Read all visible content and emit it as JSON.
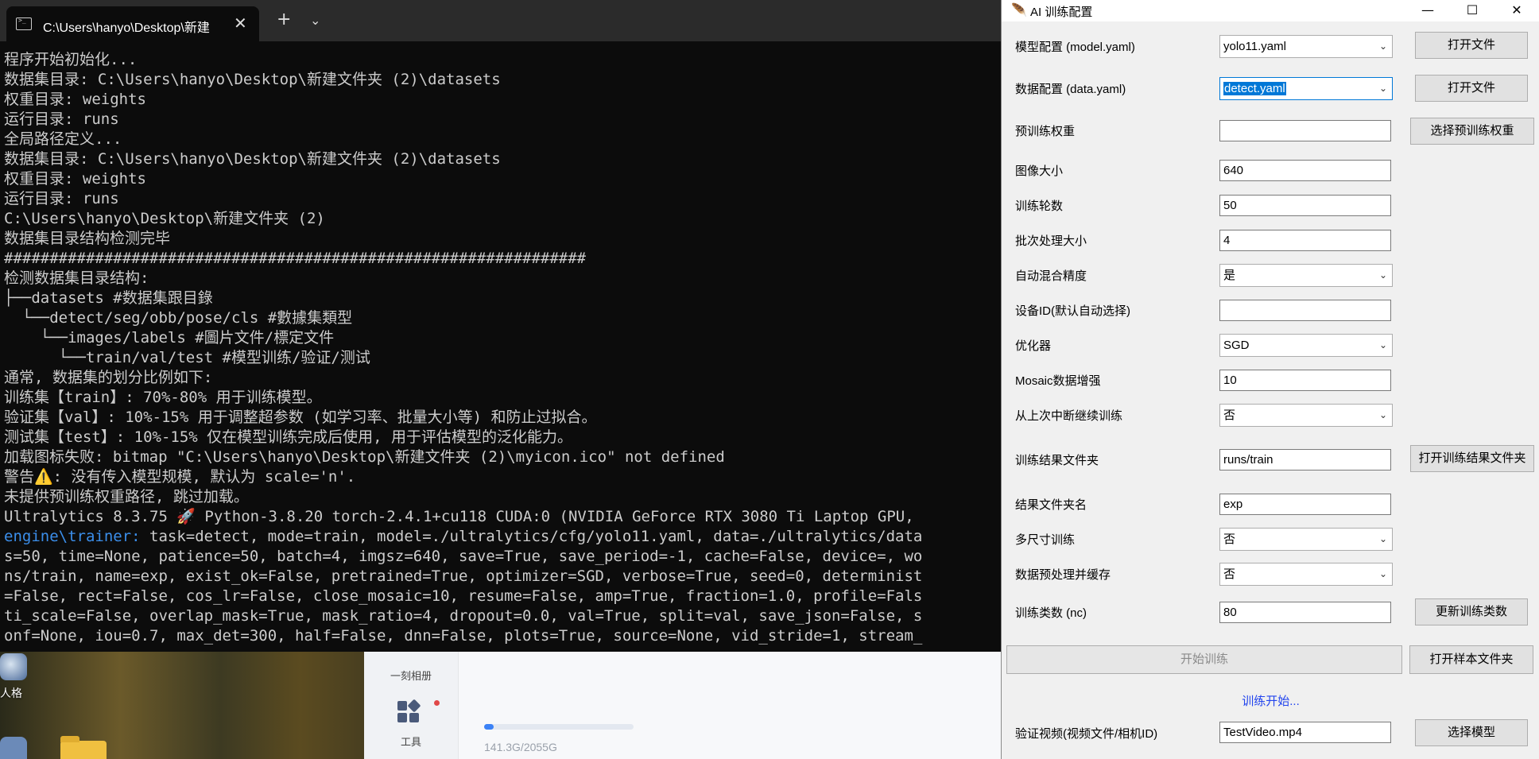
{
  "terminal": {
    "tab_title": "C:\\Users\\hanyo\\Desktop\\新建",
    "lines": [
      "程序开始初始化...",
      "数据集目录: C:\\Users\\hanyo\\Desktop\\新建文件夹 (2)\\datasets",
      "权重目录: weights",
      "运行目录: runs",
      "全局路径定义...",
      "数据集目录: C:\\Users\\hanyo\\Desktop\\新建文件夹 (2)\\datasets",
      "权重目录: weights",
      "运行目录: runs",
      "C:\\Users\\hanyo\\Desktop\\新建文件夹 (2)",
      "数据集目录结构检测完毕",
      "################################################################",
      "检测数据集目录结构:",
      "├──datasets #数据集跟目錄",
      "  └──detect/seg/obb/pose/cls #數據集類型",
      "    └──images/labels #圖片文件/標定文件",
      "      └──train/val/test #模型训练/验证/测试",
      "通常, 数据集的划分比例如下:",
      "训练集【train】: 70%-80% 用于训练模型。",
      "验证集【val】: 10%-15% 用于调整超参数 (如学习率、批量大小等) 和防止过拟合。",
      "测试集【test】: 10%-15% 仅在模型训练完成后使用, 用于评估模型的泛化能力。",
      "加载图标失败: bitmap \"C:\\Users\\hanyo\\Desktop\\新建文件夹 (2)\\myicon.ico\" not defined",
      "警告⚠️: 没有传入模型规模, 默认为 scale='n'.",
      "未提供预训练权重路径, 跳过加载。",
      "Ultralytics 8.3.75 🚀 Python-3.8.20 torch-2.4.1+cu118 CUDA:0 (NVIDIA GeForce RTX 3080 Ti Laptop GPU,",
      " task=detect, mode=train, model=./ultralytics/cfg/yolo11.yaml, data=./ultralytics/data",
      "s=50, time=None, patience=50, batch=4, imgsz=640, save=True, save_period=-1, cache=False, device=, wo",
      "ns/train, name=exp, exist_ok=False, pretrained=True, optimizer=SGD, verbose=True, seed=0, determinist",
      "=False, rect=False, cos_lr=False, close_mosaic=10, resume=False, amp=True, fraction=1.0, profile=Fals",
      "ti_scale=False, overlap_mask=True, mask_ratio=4, dropout=0.0, val=True, split=val, save_json=False, s",
      "onf=None, iou=0.7, max_det=300, half=False, dnn=False, plots=True, source=None, vid_stride=1, stream_"
    ],
    "engine_prefix": "engine\\trainer:"
  },
  "desktop": {
    "icon_label": "人格",
    "app_side_item1": "一刻相册",
    "app_side_item2": "工具",
    "storage_text": "141.3G/2055G",
    "storage_fraction": 0.064
  },
  "window": {
    "title": "AI 训练配置",
    "rows": [
      {
        "label": "模型配置 (model.yaml)",
        "kind": "combo",
        "value": "yolo11.yaml",
        "button": "打开文件"
      },
      {
        "label": "数据配置 (data.yaml)",
        "kind": "combo-focused",
        "value": "detect.yaml",
        "button": "打开文件"
      },
      {
        "label": "预训练权重",
        "kind": "entry",
        "value": "",
        "button": "选择预训练权重"
      },
      {
        "label": "图像大小",
        "kind": "entry",
        "value": "640"
      },
      {
        "label": "训练轮数",
        "kind": "entry",
        "value": "50"
      },
      {
        "label": "批次处理大小",
        "kind": "entry",
        "value": "4"
      },
      {
        "label": "自动混合精度",
        "kind": "combo",
        "value": "是"
      },
      {
        "label": "设备ID(默认自动选择)",
        "kind": "entry",
        "value": ""
      },
      {
        "label": "优化器",
        "kind": "combo",
        "value": "SGD"
      },
      {
        "label": "Mosaic数据增强",
        "kind": "entry",
        "value": "10"
      },
      {
        "label": "从上次中断继续训练",
        "kind": "combo",
        "value": "否"
      },
      {
        "label": "训练结果文件夹",
        "kind": "entry",
        "value": "runs/train",
        "button": "打开训练结果文件夹"
      },
      {
        "label": "结果文件夹名",
        "kind": "entry",
        "value": "exp"
      },
      {
        "label": "多尺寸训练",
        "kind": "combo",
        "value": "否"
      },
      {
        "label": "数据预处理并缓存",
        "kind": "combo",
        "value": "否"
      },
      {
        "label": "训练类数 (nc)",
        "kind": "entry",
        "value": "80",
        "button": "更新训练类数"
      }
    ],
    "start_button": "开始训练",
    "open_samples_button": "打开样本文件夹",
    "status_text": "训练开始...",
    "video_label": "验证视频(视频文件/相机ID)",
    "video_value": "TestVideo.mp4",
    "select_model_button": "选择模型"
  }
}
